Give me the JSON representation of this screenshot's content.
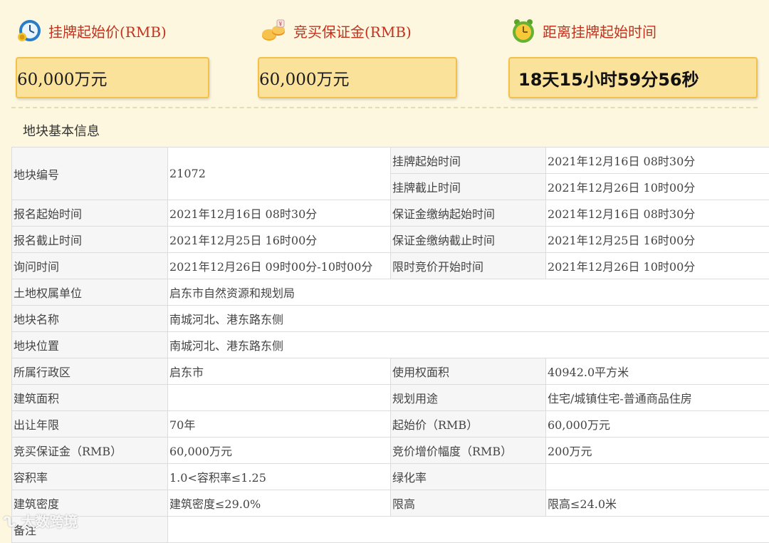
{
  "header": {
    "start_price_label": "挂牌起始价(RMB)",
    "deposit_label": "竞买保证金(RMB)",
    "countdown_label": "距离挂牌起始时间",
    "start_price_value": "60,000万元",
    "deposit_value": "60,000万元",
    "countdown_value": "18天15小时59分56秒"
  },
  "section_title": "地块基本信息",
  "table": {
    "r1": {
      "l1": "地块编号",
      "v1": "21072",
      "l2": "挂牌起始时间",
      "v2": "2021年12月16日 08时30分"
    },
    "r2": {
      "l2": "挂牌截止时间",
      "v2": "2021年12月26日 10时00分"
    },
    "r3": {
      "l1": "报名起始时间",
      "v1": "2021年12月16日 08时30分",
      "l2": "保证金缴纳起始时间",
      "v2": "2021年12月16日 08时30分"
    },
    "r4": {
      "l1": "报名截止时间",
      "v1": "2021年12月25日 16时00分",
      "l2": "保证金缴纳截止时间",
      "v2": "2021年12月25日 16时00分"
    },
    "r5": {
      "l1": "询问时间",
      "v1": "2021年12月26日 09时00分-10时00分",
      "l2": "限时竞价开始时间",
      "v2": "2021年12月26日 10时00分"
    },
    "r6": {
      "l1": "土地权属单位",
      "v1": "启东市自然资源和规划局"
    },
    "r7": {
      "l1": "地块名称",
      "v1": "南城河北、港东路东侧"
    },
    "r8": {
      "l1": "地块位置",
      "v1": "南城河北、港东路东侧"
    },
    "r9": {
      "l1": "所属行政区",
      "v1": "启东市",
      "l2": "使用权面积",
      "v2": "40942.0平方米"
    },
    "r10": {
      "l1": "建筑面积",
      "v1": "",
      "l2": "规划用途",
      "v2": "住宅/城镇住宅-普通商品住房"
    },
    "r11": {
      "l1": "出让年限",
      "v1": "70年",
      "l2": "起始价（RMB）",
      "v2": "60,000万元"
    },
    "r12": {
      "l1": "竞买保证金（RMB）",
      "v1": "60,000万元",
      "l2": "竞价增价幅度（RMB）",
      "v2": "200万元"
    },
    "r13": {
      "l1": "容积率",
      "v1": "1.0<容积率≤1.25",
      "l2": "绿化率",
      "v2": ""
    },
    "r14": {
      "l1": "建筑密度",
      "v1": "建筑密度≤29.0%",
      "l2": "限高",
      "v2": "限高≤24.0米"
    },
    "r15": {
      "l1": "备注",
      "v1": ""
    }
  },
  "watermark": "大数跨境",
  "icons": {
    "start_price": "clock-money-icon",
    "deposit": "coins-icon",
    "countdown": "alarm-clock-icon"
  }
}
